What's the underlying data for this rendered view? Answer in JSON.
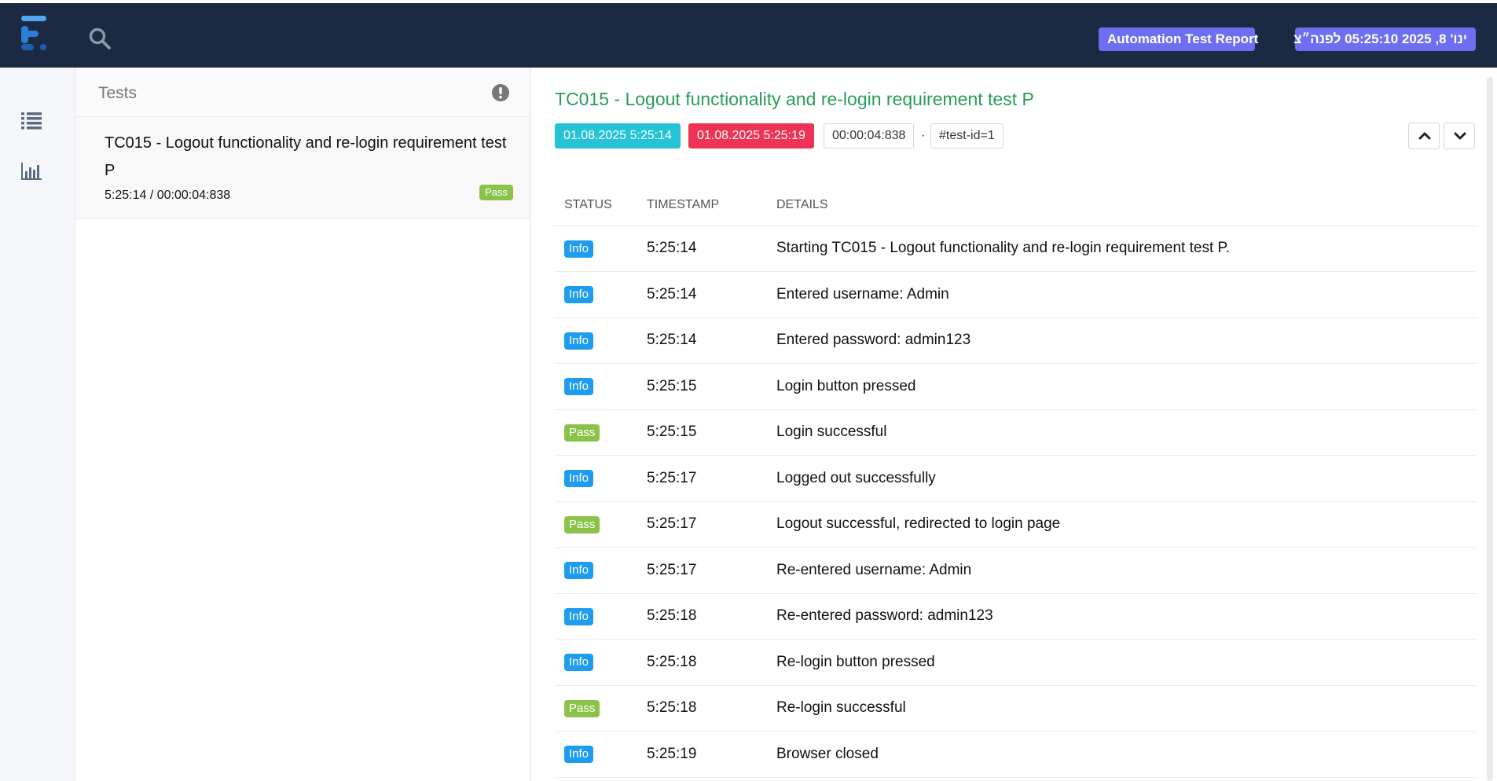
{
  "header": {
    "report_badge": "Automation Test Report",
    "date_badge": "ינו' 8, 2025 05:25:10 לפנה״צ"
  },
  "test_list": {
    "title": "Tests",
    "items": [
      {
        "name": "TC015 - Logout functionality and re-login requirement test P",
        "meta": "5:25:14 / 00:00:04:838",
        "status": "Pass"
      }
    ]
  },
  "detail": {
    "title": "TC015 - Logout functionality and re-login requirement test P",
    "start_time": "01.08.2025 5:25:14",
    "end_time": "01.08.2025 5:25:19",
    "duration": "00:00:04:838",
    "separator": "·",
    "test_id": "#test-id=1",
    "columns": [
      "STATUS",
      "TIMESTAMP",
      "DETAILS"
    ],
    "logs": [
      {
        "status": "Info",
        "time": "5:25:14",
        "details": "Starting TC015 - Logout functionality and re-login requirement test P."
      },
      {
        "status": "Info",
        "time": "5:25:14",
        "details": "Entered username: Admin"
      },
      {
        "status": "Info",
        "time": "5:25:14",
        "details": "Entered password: admin123"
      },
      {
        "status": "Info",
        "time": "5:25:15",
        "details": "Login button pressed"
      },
      {
        "status": "Pass",
        "time": "5:25:15",
        "details": "Login successful"
      },
      {
        "status": "Info",
        "time": "5:25:17",
        "details": "Logged out successfully"
      },
      {
        "status": "Pass",
        "time": "5:25:17",
        "details": "Logout successful, redirected to login page"
      },
      {
        "status": "Info",
        "time": "5:25:17",
        "details": "Re-entered username: Admin"
      },
      {
        "status": "Info",
        "time": "5:25:18",
        "details": "Re-entered password: admin123"
      },
      {
        "status": "Info",
        "time": "5:25:18",
        "details": "Re-login button pressed"
      },
      {
        "status": "Pass",
        "time": "5:25:18",
        "details": "Re-login successful"
      },
      {
        "status": "Info",
        "time": "5:25:19",
        "details": "Browser closed"
      }
    ]
  },
  "colors": {
    "topbar": "#1b2a42",
    "badge": "#6d6ff0",
    "title_green": "#2a9d57",
    "start_chip": "#25c3d5",
    "end_chip": "#ee3355",
    "info": "#1e9cef",
    "pass": "#8bc34a"
  },
  "icons": {
    "logo": "extent-logo-icon",
    "search": "search-icon",
    "list": "list-icon",
    "dashboard": "bar-chart-icon",
    "alert": "exclamation-circle-icon",
    "up": "chevron-up-icon",
    "down": "chevron-down-icon"
  }
}
